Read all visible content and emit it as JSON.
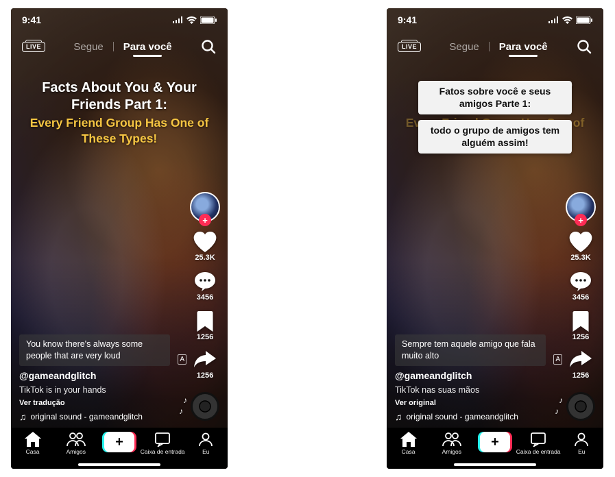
{
  "status": {
    "time": "9:41"
  },
  "topnav": {
    "live_label": "LIVE",
    "follow_tab": "Segue",
    "foryou_tab": "Para você"
  },
  "headline": {
    "line1": "Facts About You & Your Friends Part 1:",
    "line2": "Every Friend Group Has One of These Types!"
  },
  "translated_boxes": {
    "box1": "Fatos sobre você e seus amigos Parte 1:",
    "box2": "todo o grupo de amigos tem alguém assim!"
  },
  "rail": {
    "likes": "25.3K",
    "comments": "3456",
    "saves": "1256",
    "shares": "1256"
  },
  "left": {
    "subtitle": "You know there's always some people that are very loud",
    "username": "@gameandglitch",
    "description": "TikTok is in your hands",
    "translate_link": "Ver tradução",
    "sound": "original sound - gameandglitch"
  },
  "right": {
    "subtitle": "Sempre tem aquele amigo que fala muito alto",
    "username": "@gameandglitch",
    "description": "TikTok nas suas mãos",
    "translate_link": "Ver original",
    "sound": "original sound - gameandglitch"
  },
  "tabbar": {
    "home": "Casa",
    "friends": "Amigos",
    "inbox": "Caixa de entrada",
    "profile": "Eu"
  }
}
